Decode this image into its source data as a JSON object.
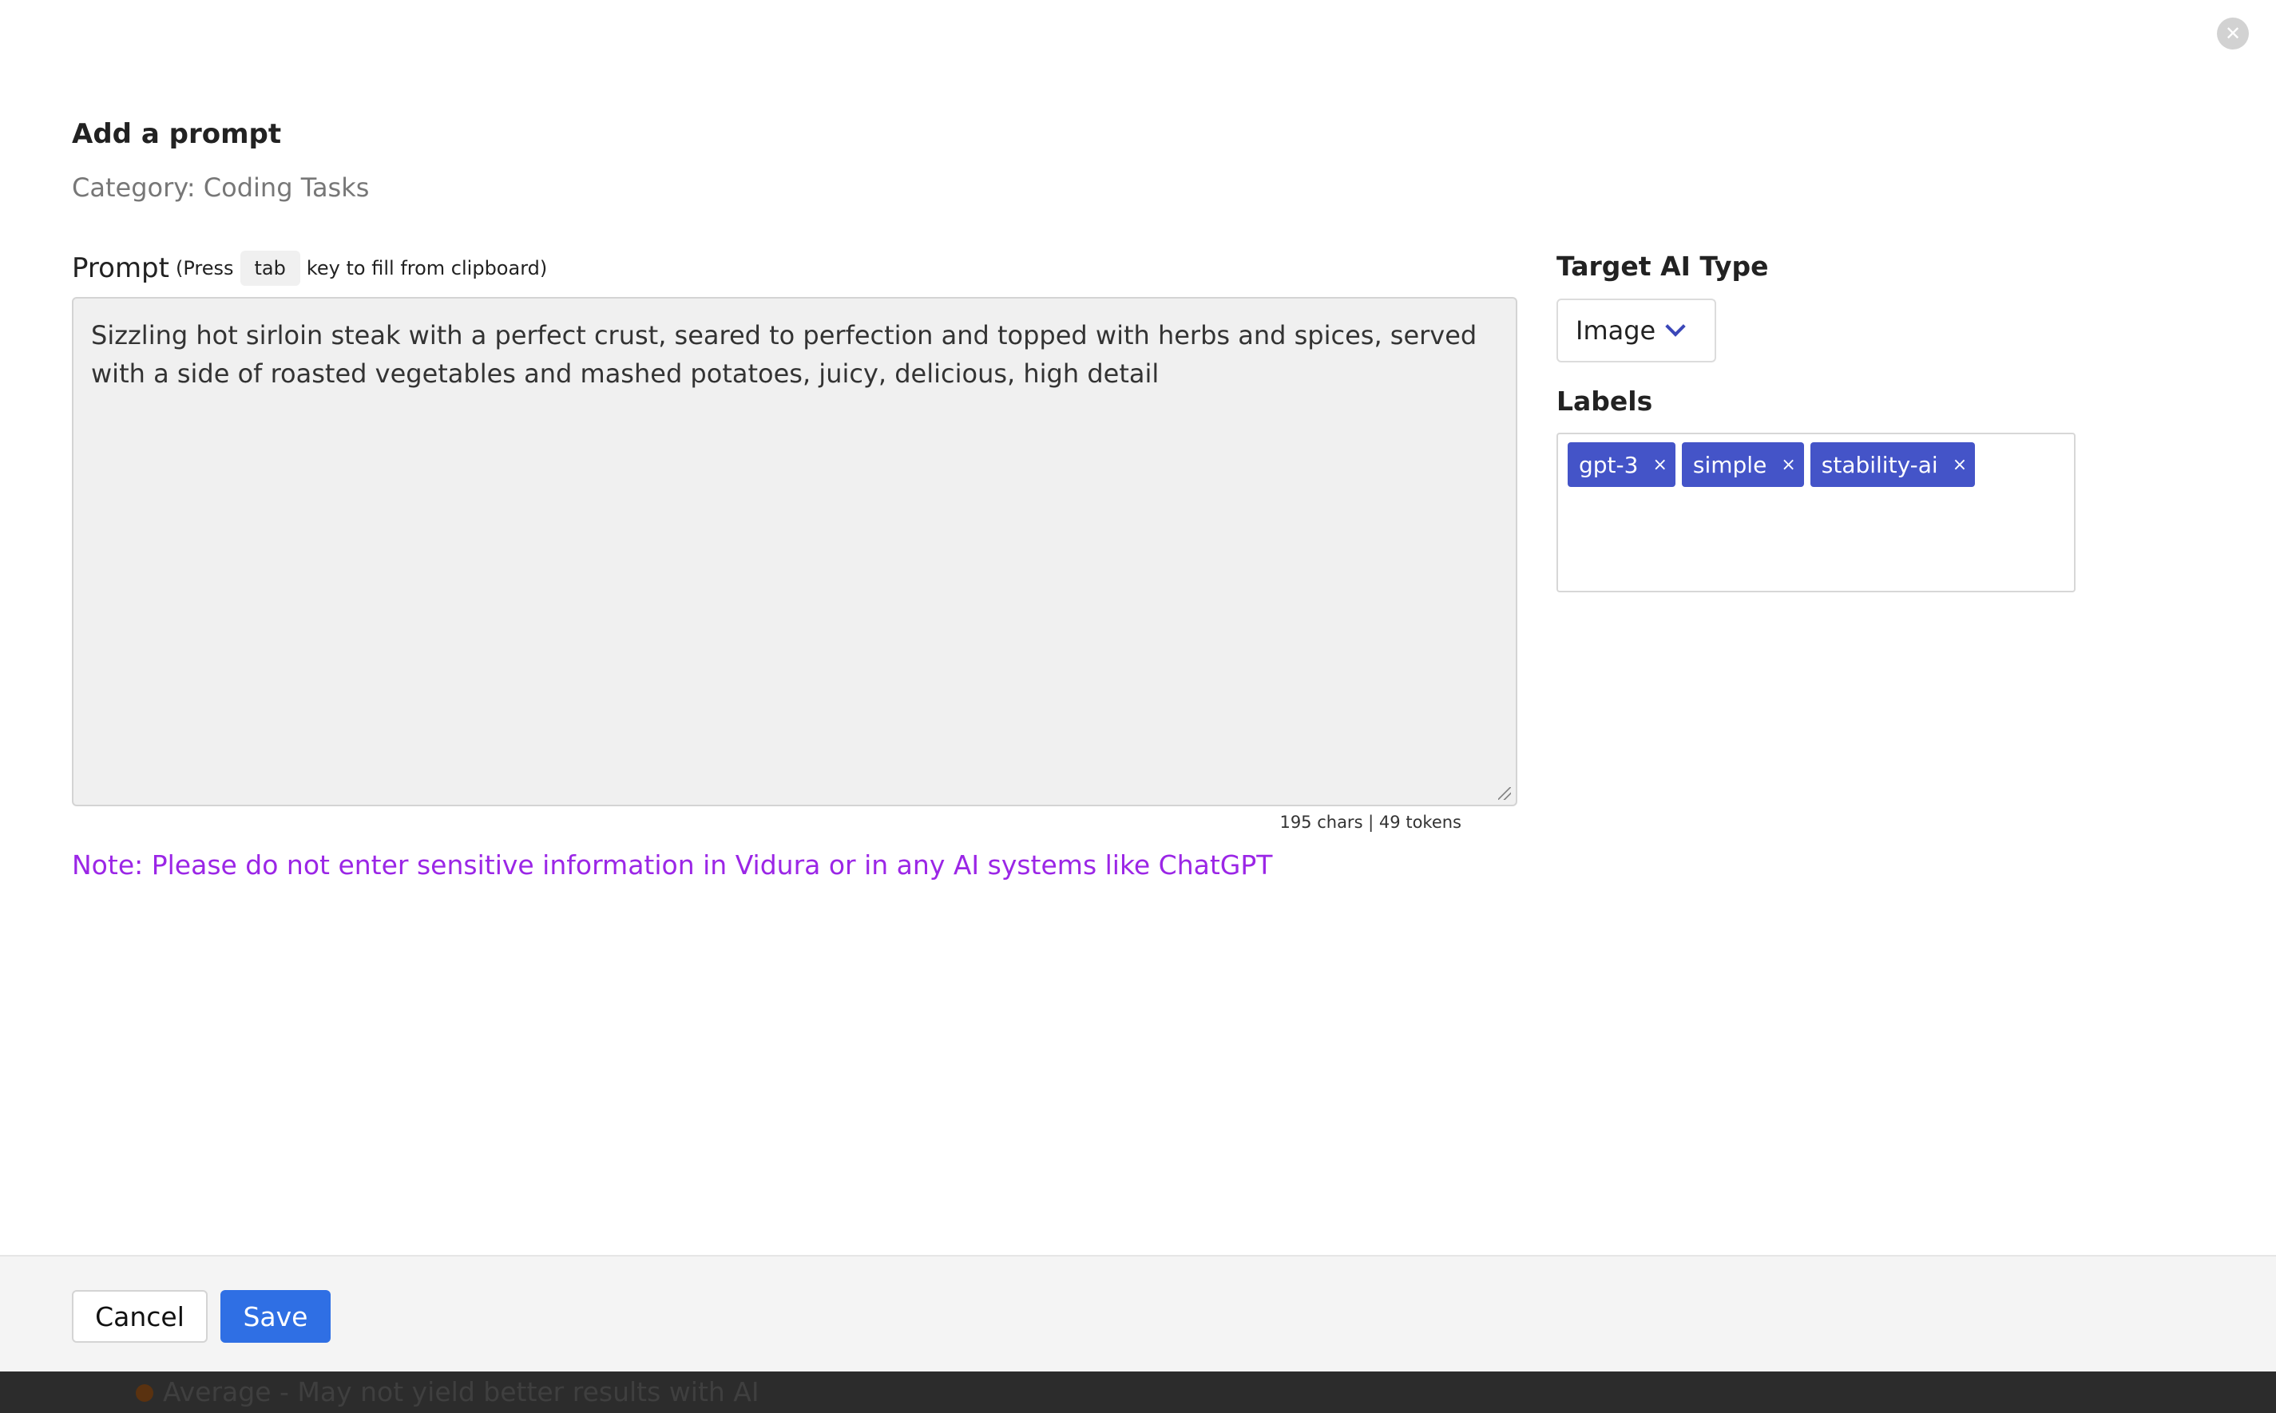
{
  "dialog": {
    "title": "Add a prompt",
    "category": "Category: Coding Tasks",
    "close_icon": "close-icon"
  },
  "prompt": {
    "label": "Prompt",
    "hint_prefix": "(Press",
    "hint_key": "tab",
    "hint_suffix": "key to fill from clipboard)",
    "value": "Sizzling hot sirloin steak with a perfect crust, seared to perfection and topped with herbs and spices, served with a side of roasted vegetables and mashed potatoes, juicy, delicious, high detail",
    "counter": "195 chars | 49 tokens"
  },
  "note": "Note: Please do not enter sensitive information in Vidura or in any AI systems like ChatGPT",
  "target_ai": {
    "label": "Target AI Type",
    "selected": "Image",
    "icon": "chevron-down-icon"
  },
  "labels": {
    "label": "Labels",
    "tags": [
      {
        "name": "gpt-3",
        "remove": "×"
      },
      {
        "name": "simple",
        "remove": "×"
      },
      {
        "name": "stability-ai",
        "remove": "×"
      }
    ]
  },
  "footer": {
    "cancel_label": "Cancel",
    "save_label": "Save"
  },
  "background_item": {
    "text": "Average - May not yield better results with AI"
  },
  "colors": {
    "accent": "#2f6fe4",
    "tag": "#4454c8",
    "note": "#9b26e6"
  }
}
